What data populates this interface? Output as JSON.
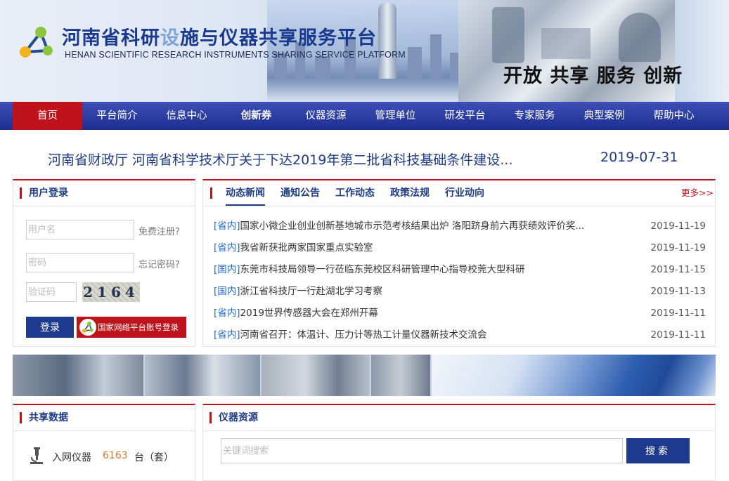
{
  "header": {
    "title_a": "河南省科研",
    "title_b": "设",
    "title_c": "施与仪器共享服务平台",
    "subtitle": "HENAN SCIENTIFIC RESEARCH INSTRUMENTS SHARING SERVICE PLATFORM",
    "slogan": "开放 共享 服务 创新"
  },
  "nav": {
    "items": [
      "首页",
      "平台简介",
      "信息中心",
      "创新券",
      "仪器资源",
      "管理单位",
      "研发平台",
      "专家服务",
      "典型案例",
      "帮助中心"
    ]
  },
  "headline": {
    "title": "河南省财政厅 河南省科学技术厅关于下达2019年第二批省科技基础条件建设...",
    "date": "2019-07-31"
  },
  "login": {
    "title": "用户登录",
    "username_placeholder": "用户名",
    "register_link": "免费注册?",
    "password_placeholder": "密码",
    "forgot_link": "忘记密码?",
    "captcha_placeholder": "验证码",
    "captcha_text": "2164",
    "login_button": "登录",
    "national_button": "国家网络平台账号登录"
  },
  "news": {
    "tabs": [
      "动态新闻",
      "通知公告",
      "工作动态",
      "政策法规",
      "行业动向"
    ],
    "more": "更多>>",
    "items": [
      {
        "tag": "[省内]",
        "title": "国家小微企业创业创新基地城市示范考核结果出炉 洛阳跻身前六再获绩效评价奖...",
        "date": "2019-11-19"
      },
      {
        "tag": "[省内]",
        "title": "我省新获批两家国家重点实验室",
        "date": "2019-11-19"
      },
      {
        "tag": "[国内]",
        "title": "东莞市科技局领导一行莅临东莞校区科研管理中心指导校莞大型科研",
        "date": "2019-11-15"
      },
      {
        "tag": "[国内]",
        "title": "浙江省科技厅一行赴湖北学习考察",
        "date": "2019-11-13"
      },
      {
        "tag": "[省内]",
        "title": "2019世界传感器大会在郑州开幕",
        "date": "2019-11-11"
      },
      {
        "tag": "[省内]",
        "title": "河南省召开：体温计、压力计等热工计量仪器新技术交流会",
        "date": "2019-11-11"
      }
    ]
  },
  "shared": {
    "title": "共享数据",
    "stat_label": "入网仪器",
    "stat_value": "6163",
    "stat_unit": "台（套）"
  },
  "instruments": {
    "title": "仪器资源",
    "search_placeholder": "关键词搜索",
    "search_button": "搜索"
  },
  "colors": {
    "brand_blue": "#1e3a8f",
    "accent_red": "#c0121a",
    "stat_orange": "#e3762b"
  }
}
